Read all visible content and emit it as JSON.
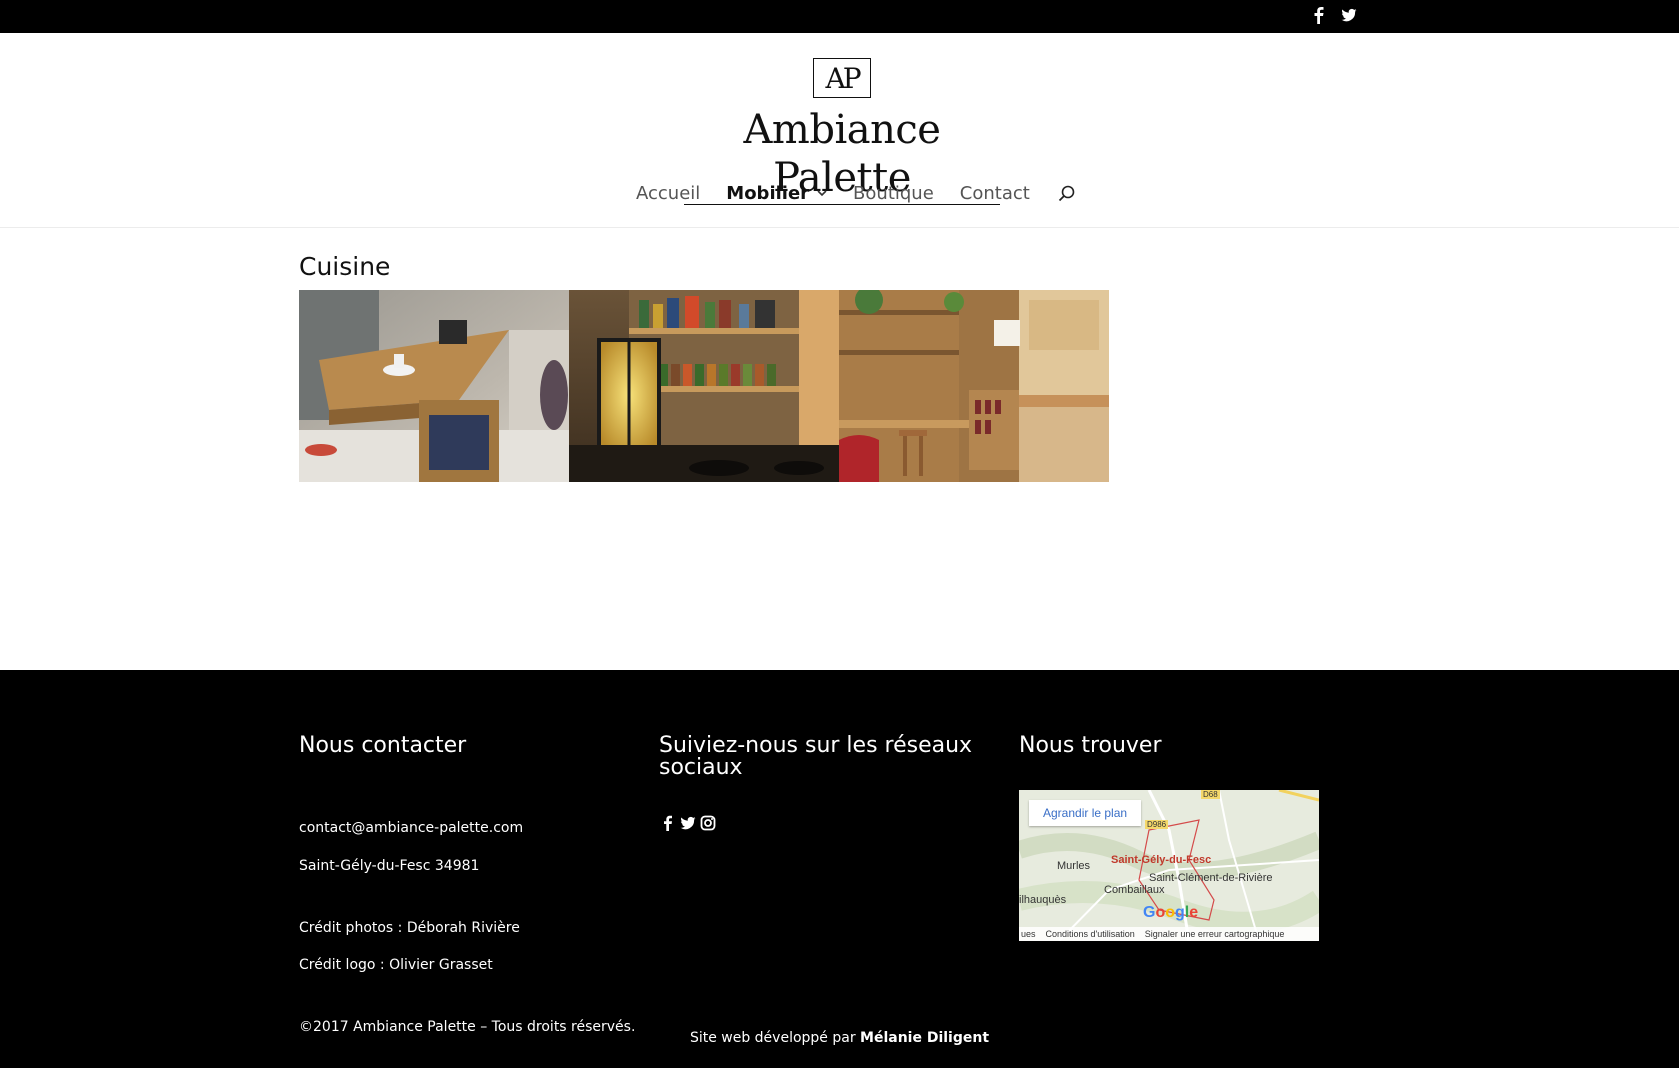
{
  "site": {
    "name": "Ambiance Palette",
    "logo_mark": "AP"
  },
  "topbar": {
    "social_icons": [
      "facebook-icon",
      "twitter-icon"
    ]
  },
  "nav": {
    "items": [
      {
        "label": "Accueil",
        "active": false
      },
      {
        "label": "Mobilier",
        "active": true,
        "has_submenu": true
      },
      {
        "label": "Boutique",
        "active": false
      },
      {
        "label": "Contact",
        "active": false
      }
    ],
    "search_icon": "search-icon"
  },
  "page": {
    "title": "Cuisine",
    "gallery": [
      {
        "alt": "kitchen-island-photo"
      },
      {
        "alt": "spice-shelf-photo"
      },
      {
        "alt": "pallet-kitchen-photo"
      }
    ]
  },
  "footer": {
    "contact": {
      "heading": "Nous contacter",
      "email": "contact@ambiance-palette.com",
      "city": "Saint-Gély-du-Fesc 34981",
      "credit_photos": "Crédit photos : Déborah Rivière",
      "credit_logo": "Crédit logo : Olivier Grasset",
      "copyright": "©2017 Ambiance Palette – Tous droits réservés."
    },
    "social": {
      "heading": "Suiviez-nous sur les réseaux sociaux",
      "icons": [
        "facebook-icon",
        "twitter-icon",
        "instagram-icon"
      ]
    },
    "map": {
      "heading": "Nous trouver",
      "enlarge_label": "Agrandir le plan",
      "labels": {
        "murles": "Murles",
        "saint_gely": "Saint-Gély-du-Fesc",
        "saint_clement": "Saint-Clément-de-Rivière",
        "combaillaux": "Combaillaux",
        "vailhauques": "ilhauquès",
        "road1": "D68",
        "road2": "D986"
      },
      "google": "Google",
      "bottom_bar": [
        "ues",
        "Conditions d'utilisation",
        "Signaler une erreur cartographique"
      ]
    },
    "dev_prefix": "Site web développé par ",
    "dev_name": "Mélanie Diligent"
  }
}
